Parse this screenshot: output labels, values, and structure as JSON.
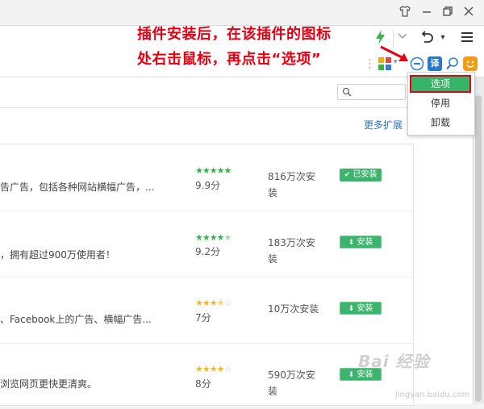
{
  "titlebar": {
    "icons": [
      "shirt-icon",
      "minimize-icon",
      "maximize-icon",
      "close-icon"
    ]
  },
  "toolbar": {
    "icons": [
      "lightning-icon",
      "chevron-down-icon",
      "undo-icon",
      "dropdown-arrow-icon",
      "menu-icon"
    ]
  },
  "extensions": {
    "icons": [
      "app-grid-icon",
      "adblock-icon",
      "translate-icon",
      "search-icon",
      "emoji-icon"
    ],
    "translate_label": "译"
  },
  "annotation": {
    "line1": "插件安装后，在该插件的图标",
    "line2": "处右击鼠标，再点击“选项”",
    "color": "#e60012"
  },
  "content": {
    "more_link": "更多扩展",
    "rows": [
      {
        "desc": "告广告，包括各种网站横幅广告，...",
        "rating": 5,
        "score": "9.9分",
        "installs": "816万次安装",
        "button": "已安装"
      },
      {
        "desc": "，拥有超过900万使用者！",
        "rating": 4.5,
        "score": "9.2分",
        "installs": "183万次安装",
        "button": "安装"
      },
      {
        "desc": "、Facebook上的广告、横幅广告...",
        "rating": 3.5,
        "score": "7分",
        "installs": "10万次安装",
        "button": "安装"
      },
      {
        "desc": "浏览网页更快更清爽。",
        "rating": 4,
        "score": "8分",
        "installs": "590万次安装",
        "button": "安装"
      }
    ]
  },
  "context_menu": {
    "items": [
      "选项",
      "停用",
      "卸载"
    ],
    "selected_index": 0,
    "highlight_color": "#36b46a"
  },
  "watermark": {
    "text": "Bai 经验",
    "sub": "jingyan.baidu.com"
  }
}
